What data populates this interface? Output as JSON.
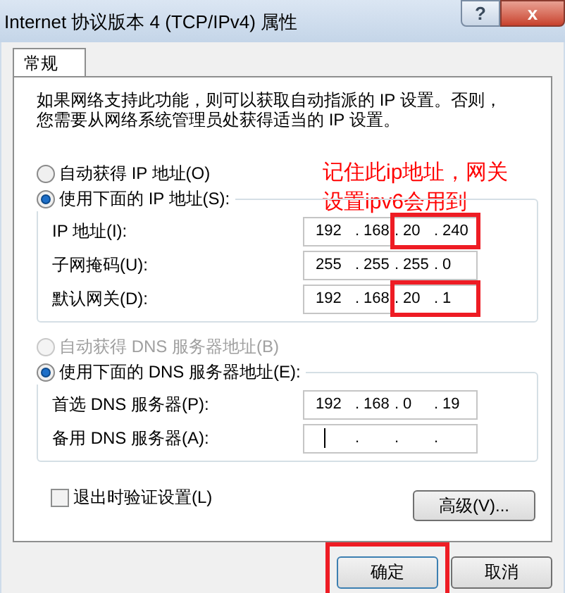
{
  "window": {
    "title": "Internet 协议版本 4 (TCP/IPv4) 属性",
    "help_label": "?",
    "close_label": "x"
  },
  "tabs": [
    {
      "label": "常规",
      "selected": true
    }
  ],
  "description": "如果网络支持此功能，则可以获取自动指派的 IP 设置。否则，您需要从网络系统管理员处获得适当的 IP 设置。",
  "annotation": {
    "text": "记住此ip地址，网关设置ipv6会用到",
    "color": "#ff0000"
  },
  "ip_section": {
    "radios": [
      {
        "label": "自动获得 IP 地址(O)",
        "selected": false,
        "disabled": false
      },
      {
        "label": "使用下面的 IP 地址(S):",
        "selected": true,
        "disabled": false
      }
    ],
    "fields": [
      {
        "label": "IP 地址(I):",
        "octets": [
          "192",
          "168",
          "20",
          "240"
        ],
        "annotated": true,
        "focused": false
      },
      {
        "label": "子网掩码(U):",
        "octets": [
          "255",
          "255",
          "255",
          "0"
        ],
        "annotated": false,
        "focused": false
      },
      {
        "label": "默认网关(D):",
        "octets": [
          "192",
          "168",
          "20",
          "1"
        ],
        "annotated": true,
        "focused": false
      }
    ]
  },
  "dns_section": {
    "radios": [
      {
        "label": "自动获得 DNS 服务器地址(B)",
        "selected": false,
        "disabled": true
      },
      {
        "label": "使用下面的 DNS 服务器地址(E):",
        "selected": true,
        "disabled": false
      }
    ],
    "fields": [
      {
        "label": "首选 DNS 服务器(P):",
        "octets": [
          "192",
          "168",
          "0",
          "19"
        ],
        "annotated": false,
        "focused": false
      },
      {
        "label": "备用 DNS 服务器(A):",
        "annotated": false,
        "focused": true
      }
    ]
  },
  "separator": ".",
  "validate_checkbox": {
    "label": "退出时验证设置(L)",
    "checked": false
  },
  "advanced_button": "高级(V)...",
  "buttons": [
    {
      "label": "确定",
      "annotated": true,
      "default": true
    },
    {
      "label": "取消",
      "annotated": false,
      "default": false
    }
  ]
}
